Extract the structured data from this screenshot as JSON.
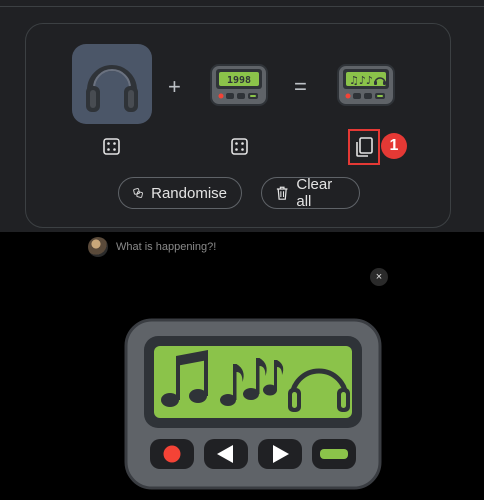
{
  "combiner": {
    "plus_symbol": "+",
    "equals_symbol": "=",
    "input_one": {
      "emoji": "headphones",
      "icon": "headphones-icon"
    },
    "input_two": {
      "emoji": "pager",
      "icon": "pager-icon",
      "screen_text": "1998"
    },
    "result": {
      "emoji": "pager with music notes and headphones",
      "icon": "music-pager-icon"
    },
    "copy_badge": "1"
  },
  "actions": {
    "randomise_label": "Randomise",
    "clear_all_label": "Clear all"
  },
  "status": {
    "message": "What is happening?!"
  },
  "preview": {
    "close_symbol": "×"
  },
  "colors": {
    "panel": "#202124",
    "pager_body": "#5f6368",
    "pager_screen": "#8bc34a",
    "highlight": "#e53935",
    "button_green": "#8bc34a",
    "button_red": "#f44336"
  }
}
